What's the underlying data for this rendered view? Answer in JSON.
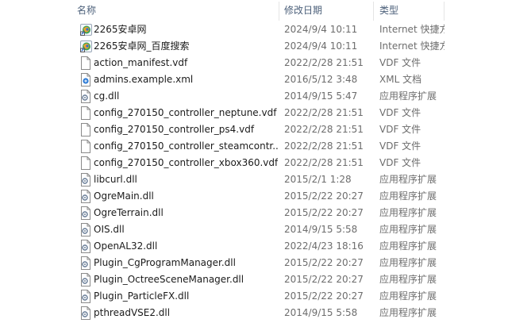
{
  "columns": {
    "name": "名称",
    "date": "修改日期",
    "type": "类型"
  },
  "files": [
    {
      "name": "2265安卓网",
      "date": "2024/9/4 10:11",
      "type": "Internet 快捷方式",
      "icon": "internet-shortcut-icon"
    },
    {
      "name": "2265安卓网_百度搜索",
      "date": "2024/9/4 10:11",
      "type": "Internet 快捷方式",
      "icon": "internet-shortcut-icon"
    },
    {
      "name": "action_manifest.vdf",
      "date": "2022/2/28 21:51",
      "type": "VDF 文件",
      "icon": "file-icon"
    },
    {
      "name": "admins.example.xml",
      "date": "2016/5/12 3:48",
      "type": "XML 文档",
      "icon": "xml-file-icon"
    },
    {
      "name": "cg.dll",
      "date": "2014/9/15 5:47",
      "type": "应用程序扩展",
      "icon": "dll-file-icon"
    },
    {
      "name": "config_270150_controller_neptune.vdf",
      "date": "2022/2/28 21:51",
      "type": "VDF 文件",
      "icon": "file-icon"
    },
    {
      "name": "config_270150_controller_ps4.vdf",
      "date": "2022/2/28 21:51",
      "type": "VDF 文件",
      "icon": "file-icon"
    },
    {
      "name": "config_270150_controller_steamcontr...",
      "date": "2022/2/28 21:51",
      "type": "VDF 文件",
      "icon": "file-icon"
    },
    {
      "name": "config_270150_controller_xbox360.vdf",
      "date": "2022/2/28 21:51",
      "type": "VDF 文件",
      "icon": "file-icon"
    },
    {
      "name": "libcurl.dll",
      "date": "2015/2/1 1:28",
      "type": "应用程序扩展",
      "icon": "dll-file-icon"
    },
    {
      "name": "OgreMain.dll",
      "date": "2015/2/22 20:27",
      "type": "应用程序扩展",
      "icon": "dll-file-icon"
    },
    {
      "name": "OgreTerrain.dll",
      "date": "2015/2/22 20:27",
      "type": "应用程序扩展",
      "icon": "dll-file-icon"
    },
    {
      "name": "OIS.dll",
      "date": "2014/9/15 5:58",
      "type": "应用程序扩展",
      "icon": "dll-file-icon"
    },
    {
      "name": "OpenAL32.dll",
      "date": "2022/4/23 18:16",
      "type": "应用程序扩展",
      "icon": "dll-file-icon"
    },
    {
      "name": "Plugin_CgProgramManager.dll",
      "date": "2015/2/22 20:27",
      "type": "应用程序扩展",
      "icon": "dll-file-icon"
    },
    {
      "name": "Plugin_OctreeSceneManager.dll",
      "date": "2015/2/22 20:27",
      "type": "应用程序扩展",
      "icon": "dll-file-icon"
    },
    {
      "name": "Plugin_ParticleFX.dll",
      "date": "2015/2/22 20:27",
      "type": "应用程序扩展",
      "icon": "dll-file-icon"
    },
    {
      "name": "pthreadVSE2.dll",
      "date": "2014/9/15 5:58",
      "type": "应用程序扩展",
      "icon": "dll-file-icon"
    }
  ]
}
